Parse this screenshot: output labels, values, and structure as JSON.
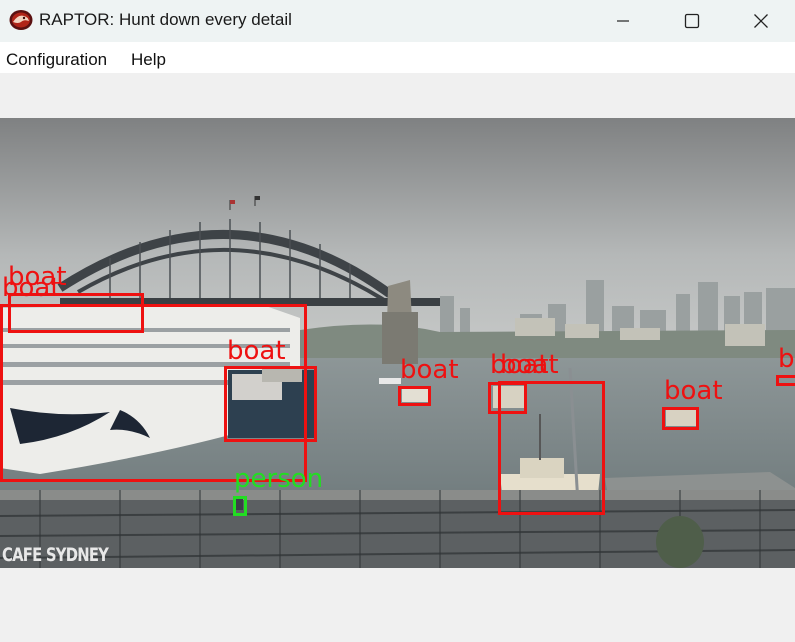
{
  "window": {
    "title": "RAPTOR: Hunt down every detail",
    "icon": "raptor-logo-icon",
    "controls": [
      "minimize-icon",
      "maximize-icon",
      "close-icon"
    ]
  },
  "menu": {
    "configuration": "Configuration",
    "help": "Help"
  },
  "image": {
    "watermark": "CAFE SYDNEY",
    "detections": [
      {
        "label": "boat",
        "color": "#ee1111"
      },
      {
        "label": "boat",
        "color": "#ee1111"
      },
      {
        "label": "boat",
        "color": "#ee1111"
      },
      {
        "label": "boat",
        "color": "#ee1111"
      },
      {
        "label": "boat",
        "color": "#ee1111"
      },
      {
        "label": "boat",
        "color": "#ee1111"
      },
      {
        "label": "boat",
        "color": "#ee1111"
      },
      {
        "label": "boat",
        "color": "#ee1111"
      },
      {
        "label": "boat",
        "color": "#ee1111"
      },
      {
        "label": "b",
        "color": "#ee1111"
      },
      {
        "label": "person",
        "color": "#22dd22"
      }
    ]
  }
}
